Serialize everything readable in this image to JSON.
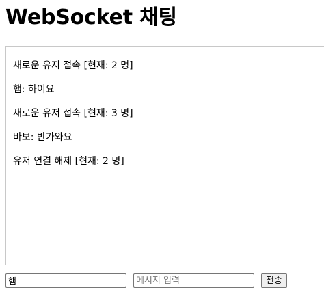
{
  "header": {
    "title": "WebSocket 채팅"
  },
  "chat": {
    "messages": [
      "새로운 유저 접속 [현재: 2 명]",
      "햄: 하이요",
      "새로운 유저 접속 [현재: 3 명]",
      "바보: 반가와요",
      "유저 연결 해제 [현재: 2 명]"
    ]
  },
  "controls": {
    "name_value": "햄",
    "message_value": "",
    "message_placeholder": "메시지 입력",
    "send_label": "전송"
  }
}
